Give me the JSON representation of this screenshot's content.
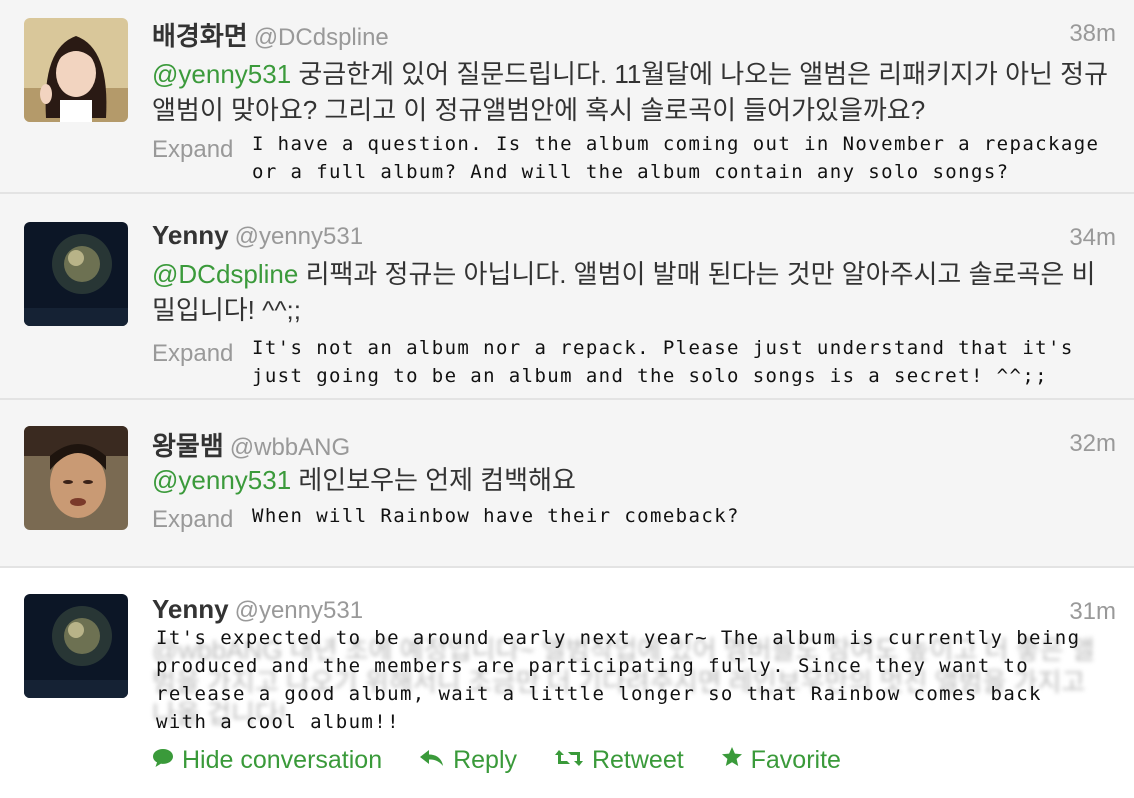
{
  "tweets": [
    {
      "name": "배경화면",
      "handle": "@DCdspline",
      "time": "38m",
      "mention": "@yenny531",
      "text": " 궁금한게 있어 질문드립니다. 11월달에 나오는 앨범은 리패키지가 아닌 정규앨범이 맞아요? 그리고 이 정규앨범안에 혹시 솔로곡이 들어가있을까요?",
      "expand": "Expand",
      "translation": "I have a question. Is the album coming out in November a repackage\nor a full album? And will the album contain any solo songs?"
    },
    {
      "name": "Yenny",
      "handle": "@yenny531",
      "time": "34m",
      "mention": "@DCdspline",
      "text": " 리팩과 정규는 아닙니다. 앨범이 발매 된다는 것만 알아주시고 솔로곡은 비밀입니다! ^^;;",
      "expand": "Expand",
      "translation": "It's not an album nor a repack. Please just understand that it's\njust going to be an album and the solo songs is a secret! ^^;;"
    },
    {
      "name": "왕물뱀",
      "handle": "@wbbANG",
      "time": "32m",
      "mention": "@yenny531",
      "text": " 레인보우는 언제 컴백해요",
      "expand": "Expand",
      "translation": "When will Rainbow have their comeback?"
    },
    {
      "name": "Yenny",
      "handle": "@yenny531",
      "time": "31m",
      "ghost_text": "@wbbANG 내년 초에 예정입니다~ 앨범작업에 있어 멤버들도 참여도 높이고 더 좋은 앨범을 가지고 나오기 위해서니 조금만 더 기다려주시면 레인보우만의 멋진 앨범을 가지고 나올 겁니다!",
      "translation": "It's expected to be around early next year~ The album is currently being\nproduced and the members are participating fully. Since they want to\nrelease a good album, wait a little longer so that Rainbow comes back\nwith a cool album!!"
    }
  ],
  "actions": {
    "hide": "Hide conversation",
    "reply": "Reply",
    "retweet": "Retweet",
    "favorite": "Favorite"
  },
  "icons": [
    "speech-bubble-icon",
    "reply-arrow-icon",
    "retweet-icon",
    "star-icon"
  ],
  "colors": {
    "accent": "#3b9a3b",
    "muted": "#999999"
  }
}
